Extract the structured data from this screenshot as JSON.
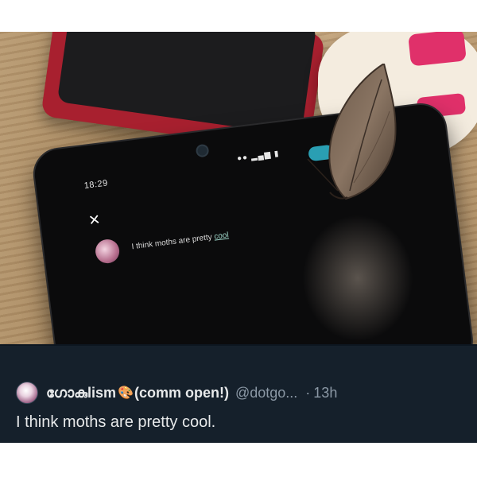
{
  "photo_phone": {
    "status_time": "18:29",
    "reply_text_prefix": "I think moths are pretty",
    "reply_text_link": "cool"
  },
  "tweet": {
    "display_name": "ഗോകുlism",
    "palette_icon": "🎨",
    "name_suffix": "(comm open!)",
    "handle": "@dotgo...",
    "separator": "·",
    "time": "13h",
    "text": "I think moths are pretty cool."
  }
}
